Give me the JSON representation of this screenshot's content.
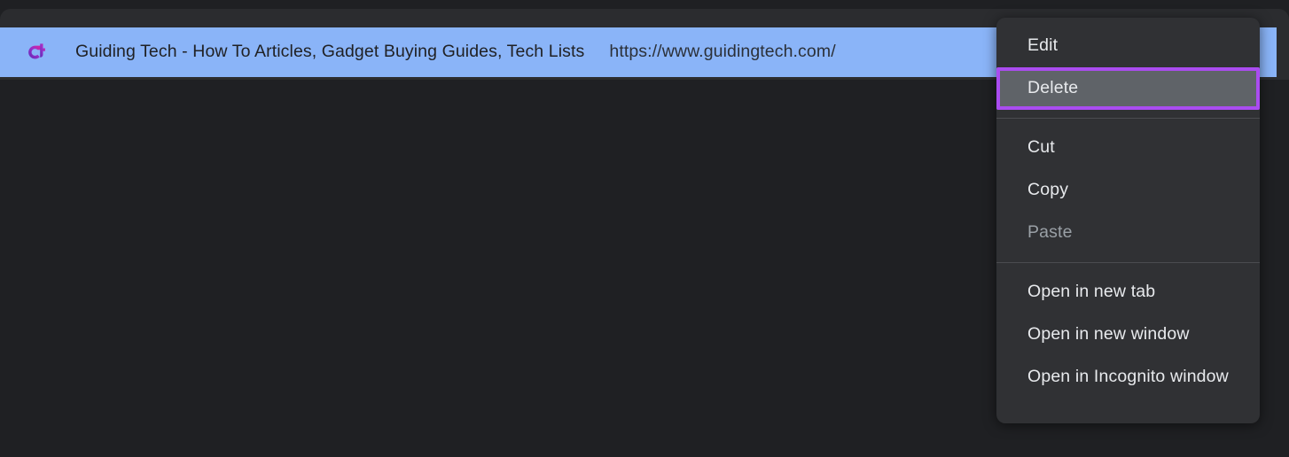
{
  "window": {
    "background_color": "#1f2023",
    "bookmark_bar_color": "#2b2c2f"
  },
  "bookmark_bar": {
    "selected_bookmark": {
      "favicon": "guidingtech-gt-logo-icon",
      "title": "Guiding Tech - How To Articles, Gadget Buying Guides, Tech Lists",
      "url": "https://www.guidingtech.com/",
      "selected": true,
      "highlight_color": "#8ab4f8",
      "text_color": "#202124"
    }
  },
  "context_menu": {
    "background_color": "#303134",
    "text_color": "#e8eaed",
    "disabled_text_color": "#9aa0a6",
    "highlight_background": "#5f6368",
    "annotation_border_color": "#aa4cf0",
    "groups": [
      {
        "items": [
          {
            "label": "Edit",
            "state": "enabled",
            "highlighted": false
          },
          {
            "label": "Delete",
            "state": "enabled",
            "highlighted": true
          }
        ]
      },
      {
        "items": [
          {
            "label": "Cut",
            "state": "enabled",
            "highlighted": false
          },
          {
            "label": "Copy",
            "state": "enabled",
            "highlighted": false
          },
          {
            "label": "Paste",
            "state": "disabled",
            "highlighted": false
          }
        ]
      },
      {
        "items": [
          {
            "label": "Open in new tab",
            "state": "enabled",
            "highlighted": false
          },
          {
            "label": "Open in new window",
            "state": "enabled",
            "highlighted": false
          },
          {
            "label": "Open in Incognito window",
            "state": "enabled",
            "highlighted": false
          }
        ]
      }
    ]
  }
}
